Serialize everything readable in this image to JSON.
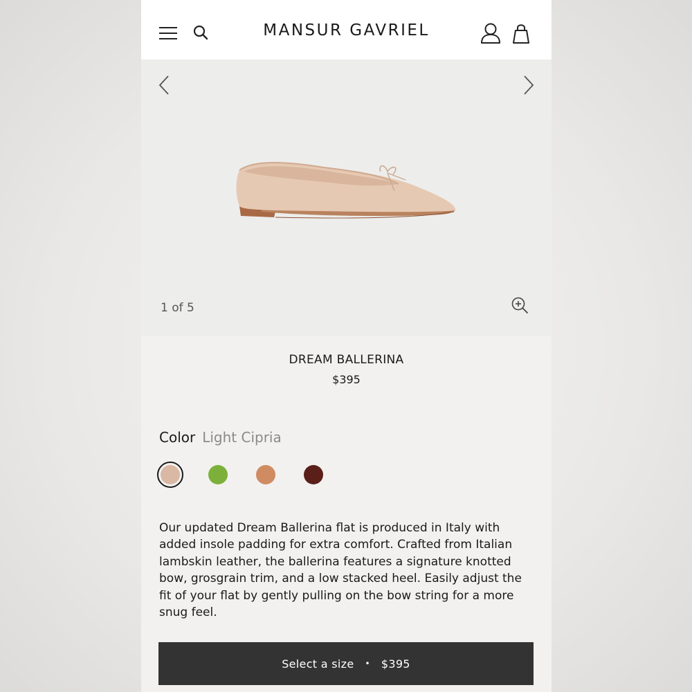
{
  "header": {
    "brand": "MANSUR GAVRIEL",
    "menu_icon": "hamburger-menu-icon",
    "search_icon": "search-icon",
    "account_icon": "account-icon",
    "bag_icon": "shopping-bag-icon"
  },
  "gallery": {
    "counter": "1 of 5",
    "current_index": 1,
    "total": 5,
    "prev_icon": "chevron-left-icon",
    "next_icon": "chevron-right-icon",
    "zoom_icon": "zoom-in-icon",
    "background": "#ededec"
  },
  "product": {
    "name": "DREAM BALLERINA",
    "price": "$395"
  },
  "color": {
    "label": "Color",
    "selected": "Light Cipria",
    "swatches": [
      {
        "color": "#d9b8a4",
        "selected": true
      },
      {
        "color": "#7cb03a",
        "selected": false
      },
      {
        "color": "#d08b62",
        "selected": false
      },
      {
        "color": "#5a1f18",
        "selected": false
      }
    ]
  },
  "description": "Our updated Dream Ballerina flat is produced in Italy with added insole padding for extra comfort. Crafted from Italian lambskin leather, the ballerina features a signature knotted bow, grosgrain trim, and a low stacked heel. Easily adjust the fit of your flat by gently pulling on the bow string for a more snug feel.",
  "cta": {
    "label": "Select a size",
    "separator": "•",
    "price": "$395",
    "background": "#333333"
  }
}
